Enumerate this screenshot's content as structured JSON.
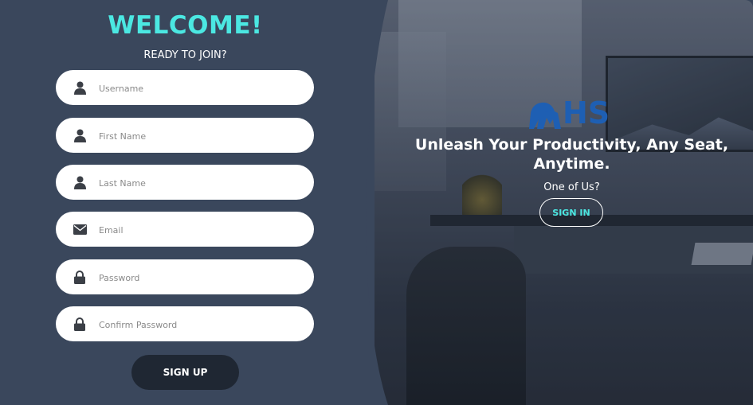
{
  "form": {
    "title": "WELCOME!",
    "subtitle": "READY TO JOIN?",
    "fields": [
      {
        "placeholder": "Username",
        "icon": "user-icon"
      },
      {
        "placeholder": "First Name",
        "icon": "user-icon"
      },
      {
        "placeholder": "Last Name",
        "icon": "user-icon"
      },
      {
        "placeholder": "Email",
        "icon": "envelope-icon"
      },
      {
        "placeholder": "Password",
        "icon": "lock-icon"
      },
      {
        "placeholder": "Confirm Password",
        "icon": "lock-icon"
      }
    ],
    "submit_label": "SIGN UP"
  },
  "hero": {
    "logo_text": "HS",
    "tagline": "Unleash Your Productivity, Any Seat, Anytime.",
    "prompt": "One of Us?",
    "signin_label": "SIGN IN"
  },
  "colors": {
    "panel_bg": "#3a475c",
    "accent": "#4be8e2",
    "button_dark": "#1f2733",
    "logo_blue": "#1e5fb3"
  }
}
